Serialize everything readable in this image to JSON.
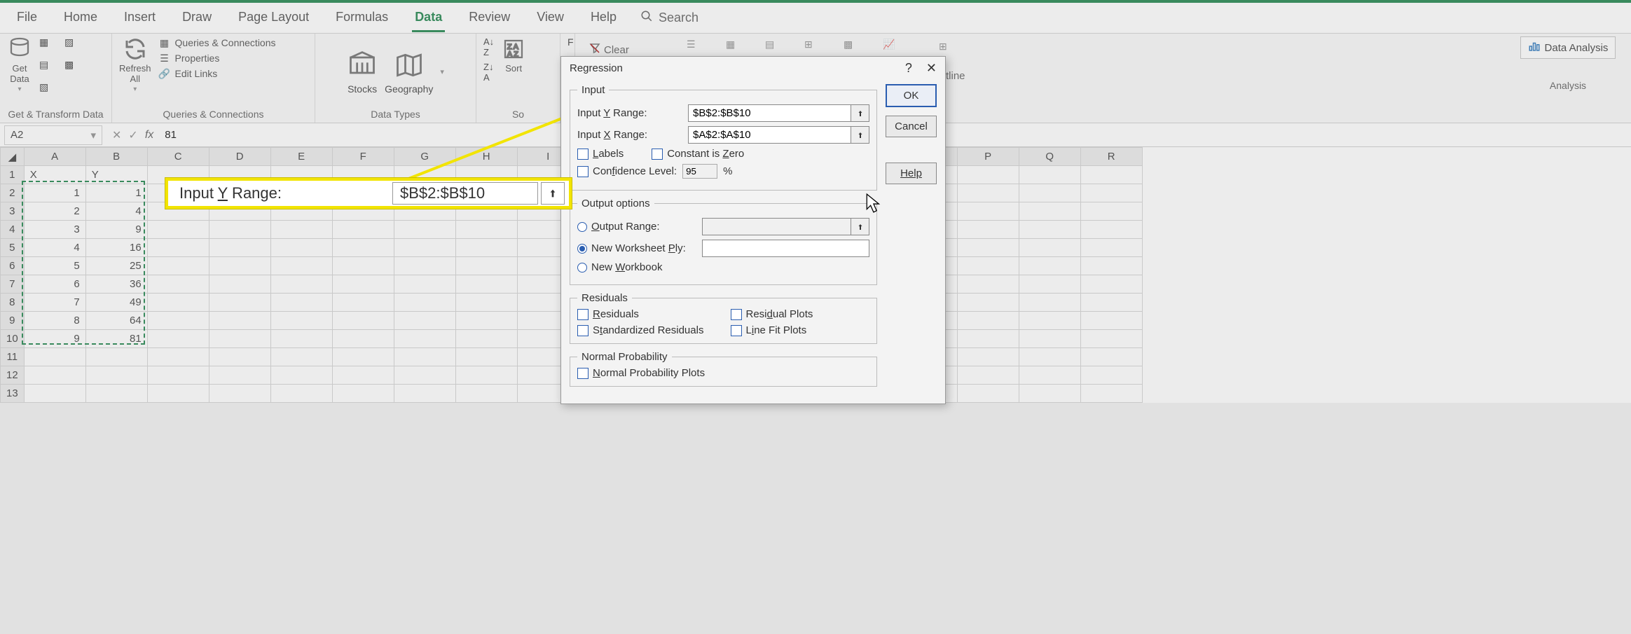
{
  "menu": {
    "tabs": [
      "File",
      "Home",
      "Insert",
      "Draw",
      "Page Layout",
      "Formulas",
      "Data",
      "Review",
      "View",
      "Help"
    ],
    "active": "Data",
    "search_label": "Search"
  },
  "ribbon": {
    "groups": {
      "get_transform": {
        "label": "Get & Transform Data",
        "get_data": "Get\nData"
      },
      "queries": {
        "label": "Queries & Connections",
        "refresh": "Refresh\nAll",
        "items": [
          "Queries & Connections",
          "Properties",
          "Edit Links"
        ]
      },
      "data_types": {
        "label": "Data Types",
        "stocks": "Stocks",
        "geography": "Geography"
      },
      "sort_filter": {
        "label": "So",
        "sort": "Sort",
        "filter": "F",
        "clear": "Clear"
      },
      "outline": {
        "label": "tline"
      },
      "analysis": {
        "label": "Analysis",
        "data_analysis": "Data Analysis"
      }
    }
  },
  "formula_bar": {
    "name_box": "A2",
    "value": "81"
  },
  "columns": [
    "A",
    "B",
    "C",
    "D",
    "E",
    "F",
    "G",
    "H",
    "I",
    "P",
    "Q",
    "R"
  ],
  "data_rows": [
    {
      "r": 1,
      "A": "X",
      "B": "Y"
    },
    {
      "r": 2,
      "A": "1",
      "B": "1"
    },
    {
      "r": 3,
      "A": "2",
      "B": "4"
    },
    {
      "r": 4,
      "A": "3",
      "B": "9"
    },
    {
      "r": 5,
      "A": "4",
      "B": "16"
    },
    {
      "r": 6,
      "A": "5",
      "B": "25"
    },
    {
      "r": 7,
      "A": "6",
      "B": "36"
    },
    {
      "r": 8,
      "A": "7",
      "B": "49"
    },
    {
      "r": 9,
      "A": "8",
      "B": "64"
    },
    {
      "r": 10,
      "A": "9",
      "B": "81"
    },
    {
      "r": 11,
      "A": "",
      "B": ""
    },
    {
      "r": 12,
      "A": "",
      "B": ""
    },
    {
      "r": 13,
      "A": "",
      "B": ""
    }
  ],
  "dialog": {
    "title": "Regression",
    "buttons": {
      "ok": "OK",
      "cancel": "Cancel",
      "help": "Help"
    },
    "input": {
      "legend": "Input",
      "y_label": "Input Y Range:",
      "y_value": "$B$2:$B$10",
      "x_label": "Input X Range:",
      "x_value": "$A$2:$A$10",
      "labels_chk": "Labels",
      "const_zero": "Constant is Zero",
      "conf_label": "Confidence Level:",
      "conf_value": "95",
      "pct": "%"
    },
    "output": {
      "legend": "Output options",
      "out_range": "Output Range:",
      "new_ws": "New Worksheet Ply:",
      "new_wb": "New Workbook"
    },
    "residuals": {
      "legend": "Residuals",
      "resid": "Residuals",
      "std": "Standardized Residuals",
      "plot": "Residual Plots",
      "line": "Line Fit Plots"
    },
    "normal": {
      "legend": "Normal Probability",
      "plots": "Normal Probability Plots"
    }
  },
  "callout": {
    "label": "Input Y Range:",
    "value": "$B$2:$B$10"
  }
}
